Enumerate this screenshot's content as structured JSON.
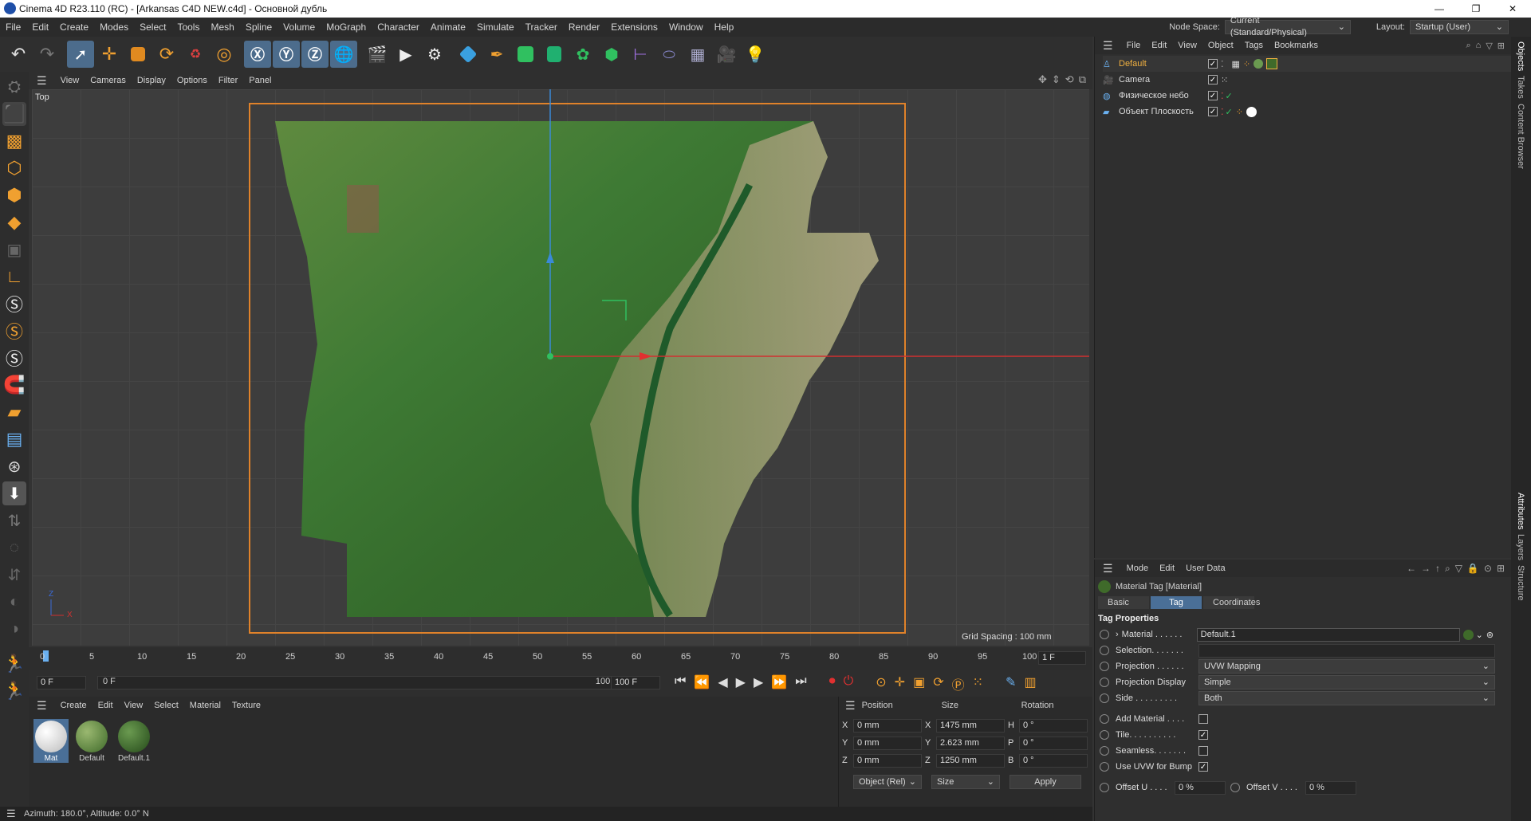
{
  "app": {
    "title": "Cinema 4D R23.110 (RC) - [Arkansas C4D NEW.c4d] - Основной дубль"
  },
  "window_controls": {
    "minimize": "—",
    "maximize": "❐",
    "close": "✕"
  },
  "menu": [
    "File",
    "Edit",
    "Create",
    "Modes",
    "Select",
    "Tools",
    "Mesh",
    "Spline",
    "Volume",
    "MoGraph",
    "Character",
    "Animate",
    "Simulate",
    "Tracker",
    "Render",
    "Extensions",
    "Window",
    "Help"
  ],
  "node_space": {
    "label": "Node Space:",
    "value": "Current (Standard/Physical)"
  },
  "layout": {
    "label": "Layout:",
    "value": "Startup (User)"
  },
  "viewport": {
    "menu": [
      "View",
      "Cameras",
      "Display",
      "Options",
      "Filter",
      "Panel"
    ],
    "view_name": "Top",
    "grid_spacing": "Grid Spacing : 100 mm",
    "axis_z": "Z",
    "axis_x": "X"
  },
  "timeline": {
    "ticks": [
      "0",
      "5",
      "10",
      "15",
      "20",
      "25",
      "30",
      "35",
      "40",
      "45",
      "50",
      "55",
      "60",
      "65",
      "70",
      "75",
      "80",
      "85",
      "90",
      "95",
      "100"
    ],
    "current_frame": "1 F",
    "start": "0 F",
    "range_start": "0 F",
    "range_end": "100 F",
    "end": "100 F"
  },
  "material_panel": {
    "menu": [
      "Create",
      "Edit",
      "View",
      "Select",
      "Material",
      "Texture"
    ],
    "materials": [
      {
        "name": "Mat",
        "color": "#e8e8e8"
      },
      {
        "name": "Default",
        "color": "#5f8a3a"
      },
      {
        "name": "Default.1",
        "color": "#3f6a2a"
      }
    ]
  },
  "coords": {
    "headers": [
      "Position",
      "Size",
      "Rotation"
    ],
    "rows": [
      {
        "axis": "X",
        "pos": "0 mm",
        "saxis": "X",
        "size": "1475 mm",
        "raxis": "H",
        "rot": "0 °"
      },
      {
        "axis": "Y",
        "pos": "0 mm",
        "saxis": "Y",
        "size": "2.623 mm",
        "raxis": "P",
        "rot": "0 °"
      },
      {
        "axis": "Z",
        "pos": "0 mm",
        "saxis": "Z",
        "size": "1250 mm",
        "raxis": "B",
        "rot": "0 °"
      }
    ],
    "mode": "Object (Rel)",
    "size_mode": "Size",
    "apply": "Apply"
  },
  "status": "Azimuth: 180.0°, Altitude: 0.0°  N",
  "objects_panel": {
    "menu": [
      "File",
      "Edit",
      "View",
      "Object",
      "Tags",
      "Bookmarks"
    ],
    "items": [
      {
        "name": "Default",
        "highlight": true
      },
      {
        "name": "Camera",
        "highlight": false
      },
      {
        "name": "Физическое небо",
        "highlight": false
      },
      {
        "name": "Объект Плоскость",
        "highlight": false
      }
    ]
  },
  "right_tabs_top": [
    "Objects",
    "Takes",
    "Content Browser"
  ],
  "right_tabs_bottom": [
    "Attributes",
    "Layers",
    "Structure"
  ],
  "attributes": {
    "menu": [
      "Mode",
      "Edit",
      "User Data"
    ],
    "title": "Material Tag [Material]",
    "tabs": [
      "Basic",
      "Tag",
      "Coordinates"
    ],
    "active_tab": "Tag",
    "section": "Tag Properties",
    "fields": [
      {
        "label": "Material . . . . . .",
        "value": "Default.1",
        "type": "link"
      },
      {
        "label": "Selection. . . . . . .",
        "value": "",
        "type": "text"
      },
      {
        "label": "Projection . . . . . .",
        "value": "UVW Mapping",
        "type": "select"
      },
      {
        "label": "Projection Display",
        "value": "Simple",
        "type": "select"
      },
      {
        "label": "Side . . . . . . . . .",
        "value": "Both",
        "type": "select"
      }
    ],
    "checks": [
      {
        "label": "Add Material . . . .",
        "checked": false
      },
      {
        "label": "Tile. . . . . . . . . .",
        "checked": true
      },
      {
        "label": "Seamless. . . . . . .",
        "checked": false
      },
      {
        "label": "Use UVW for Bump",
        "checked": true
      }
    ],
    "offset_u": {
      "label": "Offset U . . . .",
      "value": "0 %"
    },
    "offset_v": {
      "label": "Offset V . . . .",
      "value": "0 %"
    }
  }
}
